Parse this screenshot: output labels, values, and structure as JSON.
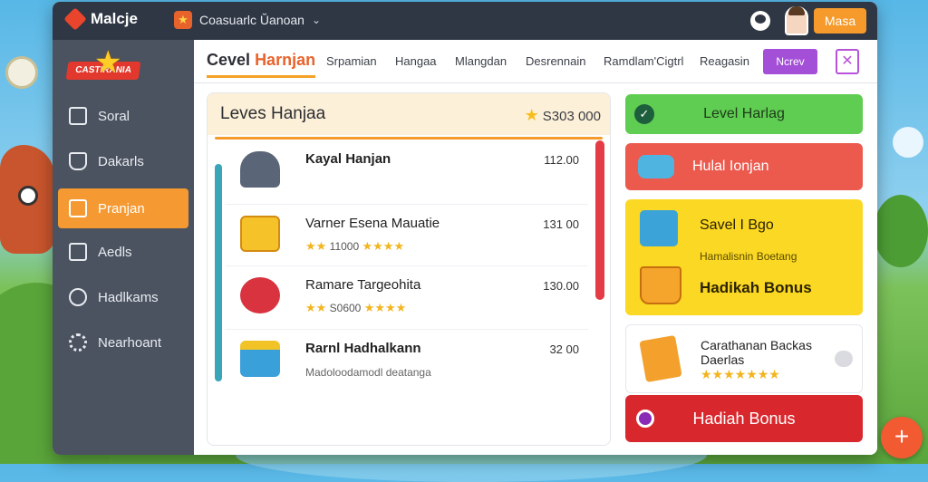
{
  "topbar": {
    "brand": "Malcje",
    "game_name": "Coasuarlc Ŭanoan",
    "button": "Masa"
  },
  "sidebar": {
    "logo_text": "CASTIRANIA",
    "items": [
      {
        "label": "Soral",
        "icon": "grid-icon"
      },
      {
        "label": "Dakarls",
        "icon": "shop-icon"
      },
      {
        "label": "Pranjan",
        "icon": "card-icon",
        "active": true
      },
      {
        "label": "Aedls",
        "icon": "calendar-icon"
      },
      {
        "label": "Hadlkams",
        "icon": "search-icon"
      },
      {
        "label": "Nearhoant",
        "icon": "gear-icon"
      }
    ]
  },
  "tabs": {
    "active_prefix": "Cevel",
    "active_highlight": "Harnjan",
    "items": [
      "Srpamian",
      "Hangaa",
      "Mlangdan",
      "Desrennain",
      "Ramdlam'Cigtrl",
      "Reagasin"
    ],
    "purple_button": "Ncrev",
    "close_symbol": "✕"
  },
  "list": {
    "title": "Leves Hanjaa",
    "score": "S303 000",
    "items": [
      {
        "name": "Kayal Hanjan",
        "sub": "",
        "stars": "",
        "price": "112.00",
        "icon": "hat-icon"
      },
      {
        "name": "Varner Esena Mauatie",
        "sub": "11000",
        "stars": "★★★★",
        "price": "131 00",
        "icon": "gift-box-icon"
      },
      {
        "name": "Ramare Targeohita",
        "sub": "S0600",
        "stars": "★★★★",
        "price": "130.00",
        "icon": "present-icon"
      },
      {
        "name": "Rarnl Hadhalkann",
        "sub": "Madoloodamodl deatanga",
        "stars": "",
        "price": "32 00",
        "icon": "basket-icon"
      }
    ]
  },
  "right": {
    "green_label": "Level Harlag",
    "red_label": "Hulal Ionjan",
    "yellow_title": "Savel I Bgo",
    "yellow_sub": "Hamalisnin Boetang",
    "yellow_bonus": "Hadikah Bonus",
    "white_title": "Carathanan Backas",
    "white_sub": "Daerlas",
    "white_stars": "★★★★★★★",
    "bonus_button": "Hadiah Bonus"
  },
  "fab": "+"
}
